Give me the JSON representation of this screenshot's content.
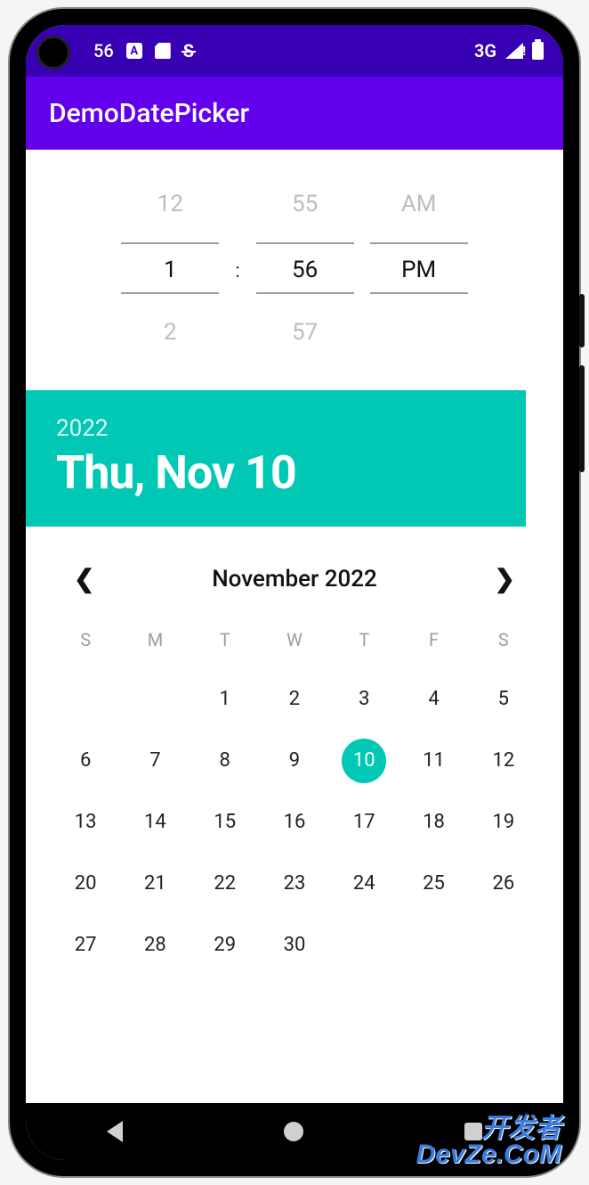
{
  "status_bar": {
    "time": "56",
    "network_label": "3G"
  },
  "app_bar": {
    "title": "DemoDatePicker"
  },
  "time_picker": {
    "hour": {
      "prev": "12",
      "selected": "1",
      "next": "2"
    },
    "minute": {
      "prev": "55",
      "selected": "56",
      "next": "57"
    },
    "ampm": {
      "prev": "AM",
      "selected": "PM",
      "next": ""
    },
    "separator": ":"
  },
  "date_header": {
    "year": "2022",
    "date_text": "Thu, Nov 10"
  },
  "calendar": {
    "title": "November 2022",
    "days_of_week": [
      "S",
      "M",
      "T",
      "W",
      "T",
      "F",
      "S"
    ],
    "leading_blanks": 2,
    "num_days": 30,
    "selected_day": 10
  },
  "watermark": {
    "line1": "开发者",
    "line2": "DevZe.CoM"
  }
}
